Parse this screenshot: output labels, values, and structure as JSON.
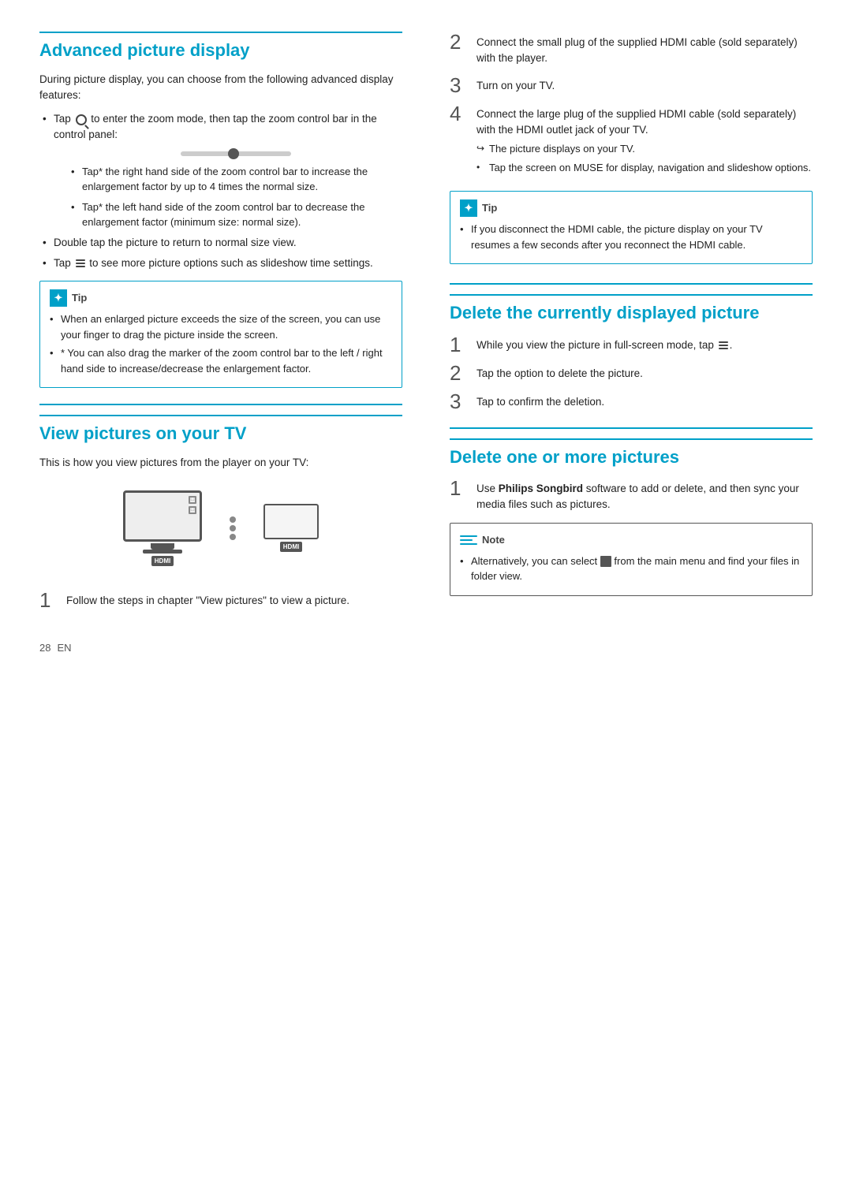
{
  "left": {
    "section1": {
      "title": "Advanced picture display",
      "intro": "During picture display, you can choose from the following advanced display features:",
      "bullet1": "Tap  to enter the zoom mode, then tap the zoom control bar in the control panel:",
      "sub_bullets": [
        "Tap* the right hand side of the zoom control bar to increase the enlargement factor by up to 4 times the normal size.",
        "Tap* the left hand side of the zoom control bar to decrease the enlargement factor (minimum size: normal size)."
      ],
      "bullet2": "Double tap the picture to return to normal size view.",
      "bullet3": "Tap  to see more picture options such as slideshow time settings.",
      "tip_header": "Tip",
      "tip_items": [
        "When an enlarged picture exceeds the size of the screen, you can use your finger to drag the picture inside the screen.",
        "* You can also drag the marker of the zoom control bar to the left / right hand side to increase/decrease the enlargement factor."
      ]
    },
    "section2": {
      "title": "View pictures on your TV",
      "intro": "This is how you view pictures from the player on your TV:",
      "step1": "Follow the steps in chapter \"View pictures\" to view a picture.",
      "step2": "Connect the small plug of the supplied HDMI cable (sold separately) with the player.",
      "step3": "Turn on your TV.",
      "step4_text": "Connect the large plug of the supplied HDMI cable (sold separately) with the HDMI outlet jack of your TV.",
      "step4_sub1": "The picture displays on your TV.",
      "step4_sub2": "Tap the screen on MUSE for display, navigation and slideshow options.",
      "tip_header": "Tip",
      "tip_items": [
        "If you disconnect the HDMI cable, the picture display on your TV resumes a few seconds after you reconnect the HDMI cable."
      ]
    }
  },
  "right": {
    "section3": {
      "title": "Delete the currently displayed picture",
      "step1": "While you view the picture in full-screen mode, tap ≡.",
      "step2": "Tap the option to delete the picture.",
      "step3": "Tap to confirm the deletion."
    },
    "section4": {
      "title": "Delete one or more pictures",
      "step1_part1": "Use ",
      "step1_brand": "Philips Songbird",
      "step1_part2": " software to add or delete, and then sync your media files such as pictures.",
      "note_header": "Note",
      "note_items": [
        "Alternatively, you can select  from the main menu and find your files in folder view."
      ]
    }
  },
  "footer": {
    "page_number": "28",
    "language": "EN"
  }
}
